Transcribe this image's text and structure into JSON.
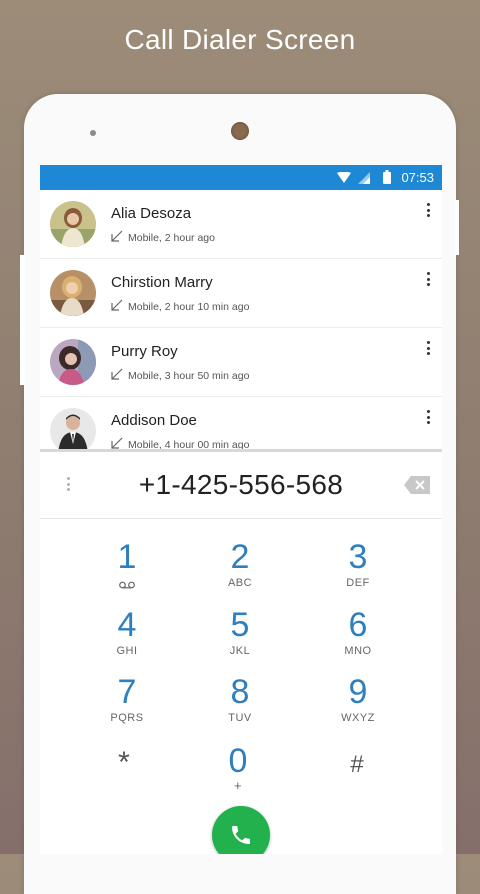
{
  "promo": {
    "title": "Call Dialer Screen"
  },
  "status_bar": {
    "time": "07:53"
  },
  "calls": [
    {
      "name": "Alia Desoza",
      "detail": "Mobile, 2 hour ago"
    },
    {
      "name": "Chirstion Marry",
      "detail": "Mobile, 2 hour 10 min ago"
    },
    {
      "name": "Purry Roy",
      "detail": "Mobile, 3 hour 50 min ago"
    },
    {
      "name": "Addison Doe",
      "detail": "Mobile, 4 hour 00 min ago"
    }
  ],
  "dialer": {
    "number": "+1-425-556-568",
    "keys": [
      {
        "digit": "1",
        "letters": ""
      },
      {
        "digit": "2",
        "letters": "ABC"
      },
      {
        "digit": "3",
        "letters": "DEF"
      },
      {
        "digit": "4",
        "letters": "GHI"
      },
      {
        "digit": "5",
        "letters": "JKL"
      },
      {
        "digit": "6",
        "letters": "MNO"
      },
      {
        "digit": "7",
        "letters": "PQRS"
      },
      {
        "digit": "8",
        "letters": "TUV"
      },
      {
        "digit": "9",
        "letters": "WXYZ"
      },
      {
        "digit": "*",
        "letters": ""
      },
      {
        "digit": "0",
        "letters": "+"
      },
      {
        "digit": "#",
        "letters": ""
      }
    ]
  },
  "colors": {
    "status_bar": "#1e88d4",
    "dial_digit": "#2f7fbe",
    "call_button": "#22b14c"
  }
}
